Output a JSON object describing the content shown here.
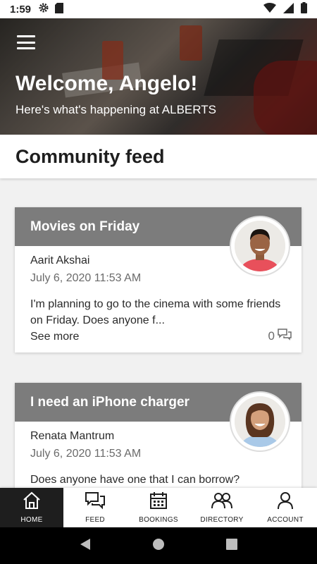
{
  "status_bar": {
    "time": "1:59"
  },
  "hero": {
    "title": "Welcome, Angelo!",
    "subtitle": "Here's what's happening at ALBERTS"
  },
  "section": {
    "title": "Community feed"
  },
  "posts": [
    {
      "title": "Movies on Friday",
      "author": "Aarit Akshai",
      "date": "July 6, 2020 11:53 AM",
      "text": "I'm planning to go to the cinema with some friends on Friday. Does anyone f...",
      "see_more": "See more",
      "comment_count": "0"
    },
    {
      "title": "I need an iPhone charger",
      "author": "Renata Mantrum",
      "date": "July 6, 2020 11:53 AM",
      "text": "Does anyone have one that I can borrow?"
    }
  ],
  "nav": {
    "items": [
      {
        "label": "HOME",
        "icon": "home-icon",
        "active": true
      },
      {
        "label": "FEED",
        "icon": "chat-icon",
        "active": false
      },
      {
        "label": "BOOKINGS",
        "icon": "calendar-icon",
        "active": false
      },
      {
        "label": "DIRECTORY",
        "icon": "people-icon",
        "active": false
      },
      {
        "label": "ACCOUNT",
        "icon": "person-icon",
        "active": false
      }
    ]
  },
  "colors": {
    "card_header": "#7c7c7c",
    "nav_active": "#1e1e1e"
  }
}
